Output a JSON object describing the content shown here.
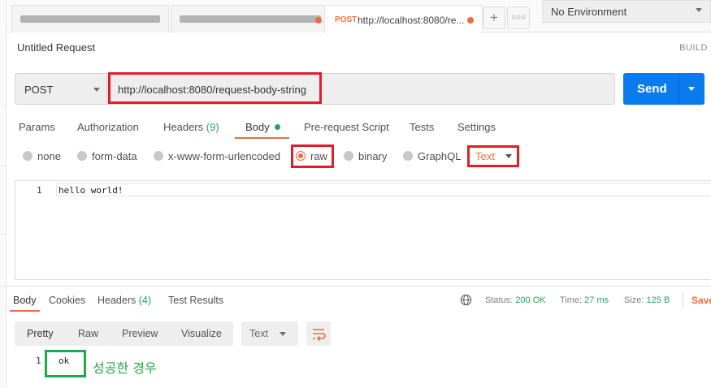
{
  "tabs": {
    "active": {
      "method": "POST",
      "url": "http://localhost:8080/re..."
    },
    "add_icon": "plus-icon",
    "more_icon": "more-icon"
  },
  "environment": {
    "selected": "No Environment"
  },
  "request": {
    "title": "Untitled Request",
    "build_label": "BUILD",
    "method": "POST",
    "url": "http://localhost:8080/request-body-string",
    "send_label": "Send"
  },
  "request_tabs": {
    "params": "Params",
    "authorization": "Authorization",
    "headers": "Headers",
    "headers_count": "(9)",
    "body": "Body",
    "pre_request": "Pre-request Script",
    "tests": "Tests",
    "settings": "Settings"
  },
  "body_types": {
    "none": "none",
    "form_data": "form-data",
    "urlencoded": "x-www-form-urlencoded",
    "raw": "raw",
    "binary": "binary",
    "graphql": "GraphQL",
    "selected": "raw",
    "format": "Text"
  },
  "editor": {
    "line_number": "1",
    "content": "hello world!"
  },
  "response_tabs": {
    "body": "Body",
    "cookies": "Cookies",
    "headers": "Headers",
    "headers_count": "(4)",
    "test_results": "Test Results"
  },
  "response_stats": {
    "status_label": "Status:",
    "status_value": "200 OK",
    "time_label": "Time:",
    "time_value": "27 ms",
    "size_label": "Size:",
    "size_value": "125 B",
    "save_label": "Save"
  },
  "view_modes": {
    "pretty": "Pretty",
    "raw": "Raw",
    "preview": "Preview",
    "visualize": "Visualize",
    "format": "Text"
  },
  "response": {
    "line_number": "1",
    "content": "ok"
  },
  "annotation": {
    "note": "성공한 경우"
  },
  "colors": {
    "accent": "#f26b3a",
    "send": "#097bed",
    "success": "#26a65b",
    "highlight_red": "#e01e26",
    "highlight_green": "#1fa94a"
  }
}
